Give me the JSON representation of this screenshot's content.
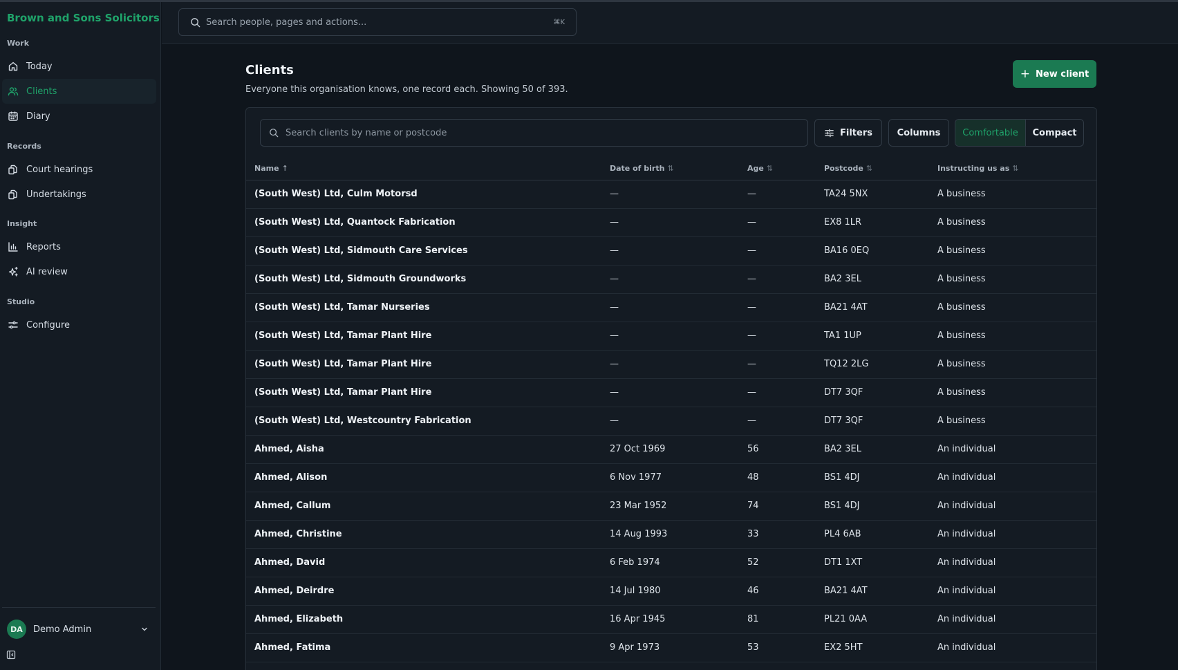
{
  "app": {
    "brand": "Brown and Sons Solicitors"
  },
  "sidebar": {
    "sections": [
      {
        "label": "Work",
        "items": [
          {
            "label": "Today",
            "icon": "home-icon"
          },
          {
            "label": "Clients",
            "icon": "users-icon",
            "active": true
          },
          {
            "label": "Diary",
            "icon": "calendar-icon"
          }
        ]
      },
      {
        "label": "Records",
        "items": [
          {
            "label": "Court hearings",
            "icon": "documents-icon"
          },
          {
            "label": "Undertakings",
            "icon": "documents-icon"
          }
        ]
      },
      {
        "label": "Insight",
        "items": [
          {
            "label": "Reports",
            "icon": "bar-chart-icon"
          },
          {
            "label": "AI review",
            "icon": "sparkles-icon"
          }
        ]
      },
      {
        "label": "Studio",
        "items": [
          {
            "label": "Configure",
            "icon": "sliders-icon"
          }
        ]
      }
    ],
    "user": {
      "initials": "DA",
      "name": "Demo Admin"
    }
  },
  "header": {
    "search_placeholder": "Search people, pages and actions...",
    "shortcut": "⌘K"
  },
  "page": {
    "title": "Clients",
    "subtitle": "Everyone this organisation knows, one record each. Showing 50 of 393.",
    "new_button": "New client"
  },
  "toolbar": {
    "search_placeholder": "Search clients by name or postcode",
    "filters_label": "Filters",
    "columns_label": "Columns",
    "density_options": [
      "Comfortable",
      "Compact"
    ],
    "density_selected": "Comfortable"
  },
  "table": {
    "columns": [
      "Name",
      "Date of birth",
      "Age",
      "Postcode",
      "Instructing us as"
    ],
    "sort": {
      "column": "Name",
      "direction": "asc"
    },
    "rows": [
      [
        "(South West) Ltd, Culm Motorsd",
        "—",
        "—",
        "TA24 5NX",
        "A business"
      ],
      [
        "(South West) Ltd, Quantock Fabrication",
        "—",
        "—",
        "EX8 1LR",
        "A business"
      ],
      [
        "(South West) Ltd, Sidmouth Care Services",
        "—",
        "—",
        "BA16 0EQ",
        "A business"
      ],
      [
        "(South West) Ltd, Sidmouth Groundworks",
        "—",
        "—",
        "BA2 3EL",
        "A business"
      ],
      [
        "(South West) Ltd, Tamar Nurseries",
        "—",
        "—",
        "BA21 4AT",
        "A business"
      ],
      [
        "(South West) Ltd, Tamar Plant Hire",
        "—",
        "—",
        "TA1 1UP",
        "A business"
      ],
      [
        "(South West) Ltd, Tamar Plant Hire",
        "—",
        "—",
        "TQ12 2LG",
        "A business"
      ],
      [
        "(South West) Ltd, Tamar Plant Hire",
        "—",
        "—",
        "DT7 3QF",
        "A business"
      ],
      [
        "(South West) Ltd, Westcountry Fabrication",
        "—",
        "—",
        "DT7 3QF",
        "A business"
      ],
      [
        "Ahmed, Aisha",
        "27 Oct 1969",
        "56",
        "BA2 3EL",
        "An individual"
      ],
      [
        "Ahmed, Alison",
        "6 Nov 1977",
        "48",
        "BS1 4DJ",
        "An individual"
      ],
      [
        "Ahmed, Callum",
        "23 Mar 1952",
        "74",
        "BS1 4DJ",
        "An individual"
      ],
      [
        "Ahmed, Christine",
        "14 Aug 1993",
        "33",
        "PL4 6AB",
        "An individual"
      ],
      [
        "Ahmed, David",
        "6 Feb 1974",
        "52",
        "DT1 1XT",
        "An individual"
      ],
      [
        "Ahmed, Deirdre",
        "14 Jul 1980",
        "46",
        "BA21 4AT",
        "An individual"
      ],
      [
        "Ahmed, Elizabeth",
        "16 Apr 1945",
        "81",
        "PL21 0AA",
        "An individual"
      ],
      [
        "Ahmed, Fatima",
        "9 Apr 1973",
        "53",
        "EX2 5HT",
        "An individual"
      ]
    ]
  },
  "colors": {
    "accent": "#1fa36a",
    "primary_button": "#1b7a52",
    "background": "#0f151c",
    "surface": "#141b23"
  }
}
